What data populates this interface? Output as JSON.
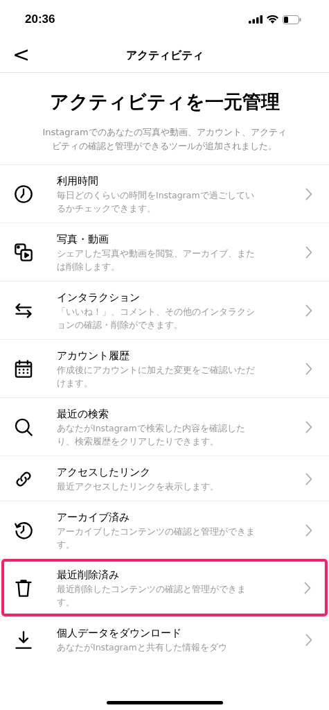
{
  "status_bar": {
    "time": "20:36"
  },
  "header": {
    "back": "<",
    "title": "アクティビティ"
  },
  "intro": {
    "heading": "アクティビティを一元管理",
    "text": "Instagramでのあなたの写真や動画、アカウント、アクティビティの確認と管理ができるツールが追加されました。"
  },
  "items": [
    {
      "title": "利用時間",
      "description": "毎日どのくらいの時間をInstagramで過ごしているかチェックできます。",
      "highlighted": false
    },
    {
      "title": "写真・動画",
      "description": "シェアした写真や動画を閲覧、アーカイブ、または削除します。",
      "highlighted": false
    },
    {
      "title": "インタラクション",
      "description": "「いいね！」、コメント、その他のインタラクションの確認・削除ができます。",
      "highlighted": false
    },
    {
      "title": "アカウント履歴",
      "description": "作成後にアカウントに加えた変更をご確認いただけます。",
      "highlighted": false
    },
    {
      "title": "最近の検索",
      "description": "あなたがInstagramで検索した内容を確認したり、検索履歴をクリアしたりできます。",
      "highlighted": false
    },
    {
      "title": "アクセスしたリンク",
      "description": "最近アクセスしたリンクを表示します。",
      "highlighted": false
    },
    {
      "title": "アーカイブ済み",
      "description": "アーカイブしたコンテンツの確認と管理ができます。",
      "highlighted": false
    },
    {
      "title": "最近削除済み",
      "description": "最近削除したコンテンツの確認と管理ができます。",
      "highlighted": true
    },
    {
      "title": "個人データをダウンロード",
      "description": "あなたがInstagramと共有した情報をダウ",
      "highlighted": false
    }
  ]
}
